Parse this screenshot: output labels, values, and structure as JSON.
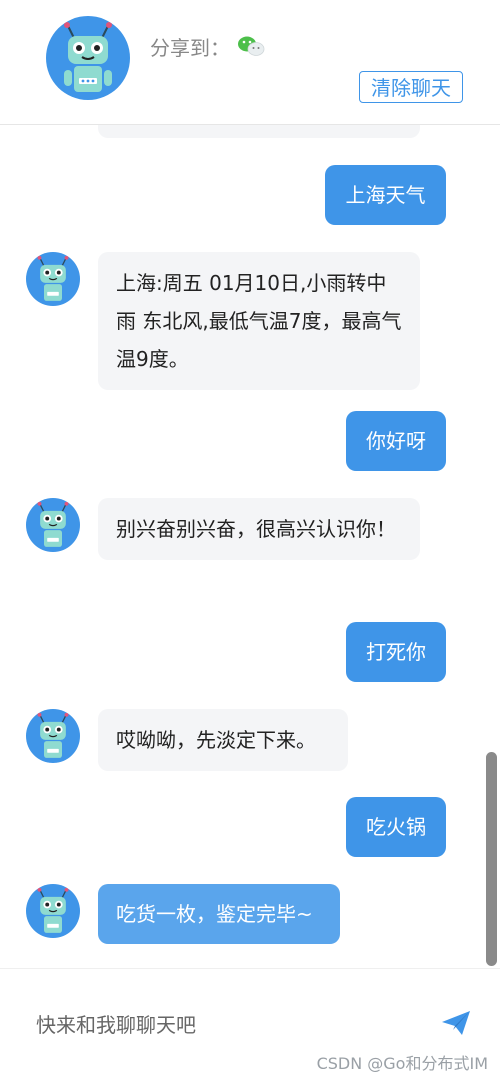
{
  "header": {
    "share_label": "分享到：",
    "clear_label": "清除聊天"
  },
  "messages": [
    {
      "from": "user",
      "text": "上海天气"
    },
    {
      "from": "bot",
      "text": "上海:周五 01月10日,小雨转中雨 东北风,最低气温7度，最高气温9度。"
    },
    {
      "from": "user",
      "text": "你好呀"
    },
    {
      "from": "bot",
      "text": "别兴奋别兴奋，很高兴认识你！"
    },
    {
      "from": "user",
      "text": "打死你"
    },
    {
      "from": "bot",
      "text": "哎呦呦，先淡定下来。"
    },
    {
      "from": "user",
      "text": "吃火锅"
    },
    {
      "from": "bot",
      "text": "吃货一枚，鉴定完毕~"
    }
  ],
  "input": {
    "placeholder": "快来和我聊聊天吧"
  },
  "watermark": "CSDN @Go和分布式IM",
  "colors": {
    "accent": "#3f95e8",
    "bot_bubble": "#f4f5f7"
  }
}
